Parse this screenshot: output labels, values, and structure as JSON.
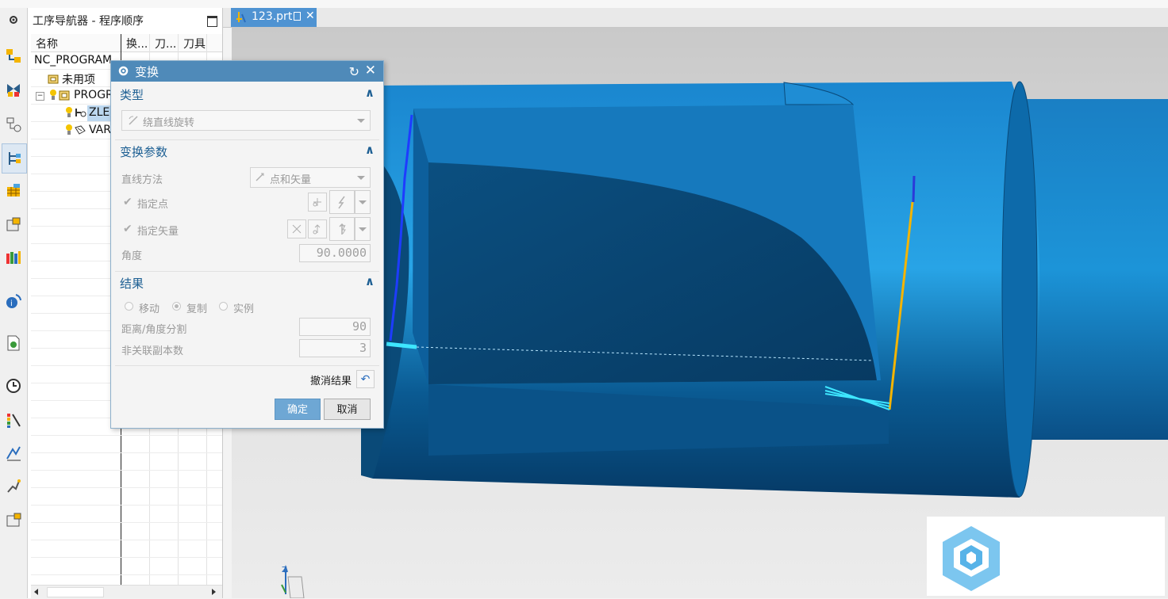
{
  "app": {
    "document_tab": "123.prt"
  },
  "navigator": {
    "title": "工序导航器 - 程序顺序",
    "columns": [
      "名称",
      "换...",
      "刀...",
      "刀具"
    ],
    "rows": [
      {
        "label": "NC_PROGRAM",
        "icon": "program-root-icon"
      },
      {
        "label": "未用项",
        "icon": "folder-icon"
      },
      {
        "label": "PROGR",
        "icon": "program-group-icon"
      },
      {
        "label": "ZLE...",
        "icon": "operation-icon",
        "selected": true
      },
      {
        "label": "VAR",
        "icon": "operation-icon"
      }
    ]
  },
  "rail_icons": [
    "settings-icon",
    "assembly-navigator-icon",
    "constraint-navigator-icon",
    "part-navigator-icon",
    "operation-navigator-icon",
    "machine-navigator-icon",
    "reuse-library-icon",
    "role-icon",
    "info-icon",
    "web-browser-icon",
    "history-icon",
    "visualization-icon",
    "analysis-icon",
    "motion-icon",
    "system-material-icon"
  ],
  "dialog": {
    "title": "变换",
    "type_section": {
      "title": "类型",
      "type_value": "绕直线旋转"
    },
    "params_section": {
      "title": "变换参数",
      "line_method_label": "直线方法",
      "line_method_value": "点和矢量",
      "specify_point_label": "指定点",
      "specify_vector_label": "指定矢量",
      "angle_label": "角度",
      "angle_value": "90.0000"
    },
    "result_section": {
      "title": "结果",
      "radio_move": "移动",
      "radio_copy": "复制",
      "radio_instance": "实例",
      "selected_radio": "复制",
      "divisions_label": "距离/角度分割",
      "divisions_value": "90",
      "copies_label": "非关联副本数",
      "copies_value": "3"
    },
    "undo_label": "撤消结果",
    "ok_label": "确定",
    "cancel_label": "取消"
  },
  "colors": {
    "dialog_title_bg": "#4f8ab9",
    "section_title": "#1d5f93",
    "part_blue": "#1f8fd6",
    "tool_yellow": "#f4b400",
    "tab_blue": "#4f93d2"
  }
}
